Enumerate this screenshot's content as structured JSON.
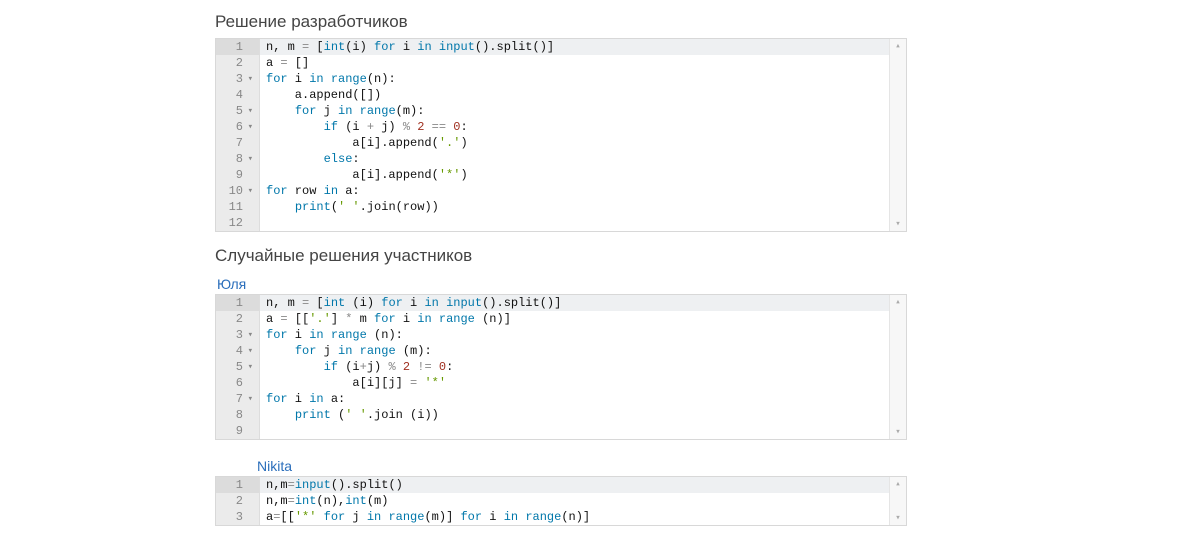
{
  "sections": [
    {
      "title": "Решение разработчиков",
      "author": null,
      "author_indent": false,
      "code": [
        {
          "n": 1,
          "fold": false,
          "active": true,
          "tokens": [
            [
              "",
              "n, m "
            ],
            [
              "op",
              "="
            ],
            [
              "",
              " ["
            ],
            [
              "fn",
              "int"
            ],
            [
              "",
              "(i) "
            ],
            [
              "kw",
              "for"
            ],
            [
              "",
              " i "
            ],
            [
              "kw",
              "in"
            ],
            [
              "",
              " "
            ],
            [
              "fn",
              "input"
            ],
            [
              "",
              "().split()]"
            ]
          ]
        },
        {
          "n": 2,
          "fold": false,
          "active": false,
          "tokens": [
            [
              "",
              "a "
            ],
            [
              "op",
              "="
            ],
            [
              "",
              " []"
            ]
          ]
        },
        {
          "n": 3,
          "fold": true,
          "active": false,
          "tokens": [
            [
              "kw",
              "for"
            ],
            [
              "",
              " i "
            ],
            [
              "kw",
              "in"
            ],
            [
              "",
              " "
            ],
            [
              "fn",
              "range"
            ],
            [
              "",
              "(n):"
            ]
          ]
        },
        {
          "n": 4,
          "fold": false,
          "active": false,
          "tokens": [
            [
              "",
              "    a.append([])"
            ]
          ]
        },
        {
          "n": 5,
          "fold": true,
          "active": false,
          "tokens": [
            [
              "",
              "    "
            ],
            [
              "kw",
              "for"
            ],
            [
              "",
              " j "
            ],
            [
              "kw",
              "in"
            ],
            [
              "",
              " "
            ],
            [
              "fn",
              "range"
            ],
            [
              "",
              "(m):"
            ]
          ]
        },
        {
          "n": 6,
          "fold": true,
          "active": false,
          "tokens": [
            [
              "",
              "        "
            ],
            [
              "kw",
              "if"
            ],
            [
              "",
              " (i "
            ],
            [
              "op",
              "+"
            ],
            [
              "",
              " j) "
            ],
            [
              "op",
              "%"
            ],
            [
              "",
              " "
            ],
            [
              "num",
              "2"
            ],
            [
              "",
              " "
            ],
            [
              "op",
              "=="
            ],
            [
              "",
              " "
            ],
            [
              "num",
              "0"
            ],
            [
              "",
              ":"
            ]
          ]
        },
        {
          "n": 7,
          "fold": false,
          "active": false,
          "tokens": [
            [
              "",
              "            a[i].append("
            ],
            [
              "str",
              "'.'"
            ],
            [
              "",
              ")"
            ]
          ]
        },
        {
          "n": 8,
          "fold": true,
          "active": false,
          "tokens": [
            [
              "",
              "        "
            ],
            [
              "kw",
              "else"
            ],
            [
              "",
              ":"
            ]
          ]
        },
        {
          "n": 9,
          "fold": false,
          "active": false,
          "tokens": [
            [
              "",
              "            a[i].append("
            ],
            [
              "str",
              "'*'"
            ],
            [
              "",
              ")"
            ]
          ]
        },
        {
          "n": 10,
          "fold": true,
          "active": false,
          "tokens": [
            [
              "kw",
              "for"
            ],
            [
              "",
              " row "
            ],
            [
              "kw",
              "in"
            ],
            [
              "",
              " a:"
            ]
          ]
        },
        {
          "n": 11,
          "fold": false,
          "active": false,
          "tokens": [
            [
              "",
              "    "
            ],
            [
              "fn",
              "print"
            ],
            [
              "",
              "("
            ],
            [
              "str",
              "' '"
            ],
            [
              "",
              ".join(row))"
            ]
          ]
        },
        {
          "n": 12,
          "fold": false,
          "active": false,
          "tokens": [
            [
              "",
              ""
            ]
          ]
        }
      ]
    },
    {
      "title": "Случайные решения участников",
      "author": "Юля",
      "author_indent": false,
      "code": [
        {
          "n": 1,
          "fold": false,
          "active": true,
          "tokens": [
            [
              "",
              "n, m "
            ],
            [
              "op",
              "="
            ],
            [
              "",
              " ["
            ],
            [
              "fn",
              "int"
            ],
            [
              "",
              " (i) "
            ],
            [
              "kw",
              "for"
            ],
            [
              "",
              " i "
            ],
            [
              "kw",
              "in"
            ],
            [
              "",
              " "
            ],
            [
              "fn",
              "input"
            ],
            [
              "",
              "().split()]"
            ]
          ]
        },
        {
          "n": 2,
          "fold": false,
          "active": false,
          "tokens": [
            [
              "",
              "a "
            ],
            [
              "op",
              "="
            ],
            [
              "",
              " [["
            ],
            [
              "str",
              "'.'"
            ],
            [
              "",
              "] "
            ],
            [
              "op",
              "*"
            ],
            [
              "",
              " m "
            ],
            [
              "kw",
              "for"
            ],
            [
              "",
              " i "
            ],
            [
              "kw",
              "in"
            ],
            [
              "",
              " "
            ],
            [
              "fn",
              "range"
            ],
            [
              "",
              " (n)]"
            ]
          ]
        },
        {
          "n": 3,
          "fold": true,
          "active": false,
          "tokens": [
            [
              "kw",
              "for"
            ],
            [
              "",
              " i "
            ],
            [
              "kw",
              "in"
            ],
            [
              "",
              " "
            ],
            [
              "fn",
              "range"
            ],
            [
              "",
              " (n):"
            ]
          ]
        },
        {
          "n": 4,
          "fold": true,
          "active": false,
          "tokens": [
            [
              "",
              "    "
            ],
            [
              "kw",
              "for"
            ],
            [
              "",
              " j "
            ],
            [
              "kw",
              "in"
            ],
            [
              "",
              " "
            ],
            [
              "fn",
              "range"
            ],
            [
              "",
              " (m):"
            ]
          ]
        },
        {
          "n": 5,
          "fold": true,
          "active": false,
          "tokens": [
            [
              "",
              "        "
            ],
            [
              "kw",
              "if"
            ],
            [
              "",
              " (i"
            ],
            [
              "op",
              "+"
            ],
            [
              "",
              "j) "
            ],
            [
              "op",
              "%"
            ],
            [
              "",
              " "
            ],
            [
              "num",
              "2"
            ],
            [
              "",
              " "
            ],
            [
              "op",
              "!="
            ],
            [
              "",
              " "
            ],
            [
              "num",
              "0"
            ],
            [
              "",
              ":"
            ]
          ]
        },
        {
          "n": 6,
          "fold": false,
          "active": false,
          "tokens": [
            [
              "",
              "            a[i][j] "
            ],
            [
              "op",
              "="
            ],
            [
              "",
              " "
            ],
            [
              "str",
              "'*'"
            ]
          ]
        },
        {
          "n": 7,
          "fold": true,
          "active": false,
          "tokens": [
            [
              "kw",
              "for"
            ],
            [
              "",
              " i "
            ],
            [
              "kw",
              "in"
            ],
            [
              "",
              " a:"
            ]
          ]
        },
        {
          "n": 8,
          "fold": false,
          "active": false,
          "tokens": [
            [
              "",
              "    "
            ],
            [
              "fn",
              "print"
            ],
            [
              "",
              " ("
            ],
            [
              "str",
              "' '"
            ],
            [
              "",
              ".join (i))"
            ]
          ]
        },
        {
          "n": 9,
          "fold": false,
          "active": false,
          "tokens": [
            [
              "",
              ""
            ]
          ]
        }
      ]
    },
    {
      "title": null,
      "author": "Nikita",
      "author_indent": true,
      "code": [
        {
          "n": 1,
          "fold": false,
          "active": true,
          "tokens": [
            [
              "",
              "n,m"
            ],
            [
              "op",
              "="
            ],
            [
              "fn",
              "input"
            ],
            [
              "",
              "().split()"
            ]
          ]
        },
        {
          "n": 2,
          "fold": false,
          "active": false,
          "tokens": [
            [
              "",
              "n,m"
            ],
            [
              "op",
              "="
            ],
            [
              "fn",
              "int"
            ],
            [
              "",
              "(n),"
            ],
            [
              "fn",
              "int"
            ],
            [
              "",
              "(m)"
            ]
          ]
        },
        {
          "n": 3,
          "fold": false,
          "active": false,
          "tokens": [
            [
              "",
              "a"
            ],
            [
              "op",
              "="
            ],
            [
              "",
              "[["
            ],
            [
              "str",
              "'*'"
            ],
            [
              "",
              " "
            ],
            [
              "kw",
              "for"
            ],
            [
              "",
              " j "
            ],
            [
              "kw",
              "in"
            ],
            [
              "",
              " "
            ],
            [
              "fn",
              "range"
            ],
            [
              "",
              "(m)] "
            ],
            [
              "kw",
              "for"
            ],
            [
              "",
              " i "
            ],
            [
              "kw",
              "in"
            ],
            [
              "",
              " "
            ],
            [
              "fn",
              "range"
            ],
            [
              "",
              "(n)]"
            ]
          ]
        }
      ]
    }
  ],
  "scroll_up_glyph": "▴",
  "scroll_down_glyph": "▾"
}
